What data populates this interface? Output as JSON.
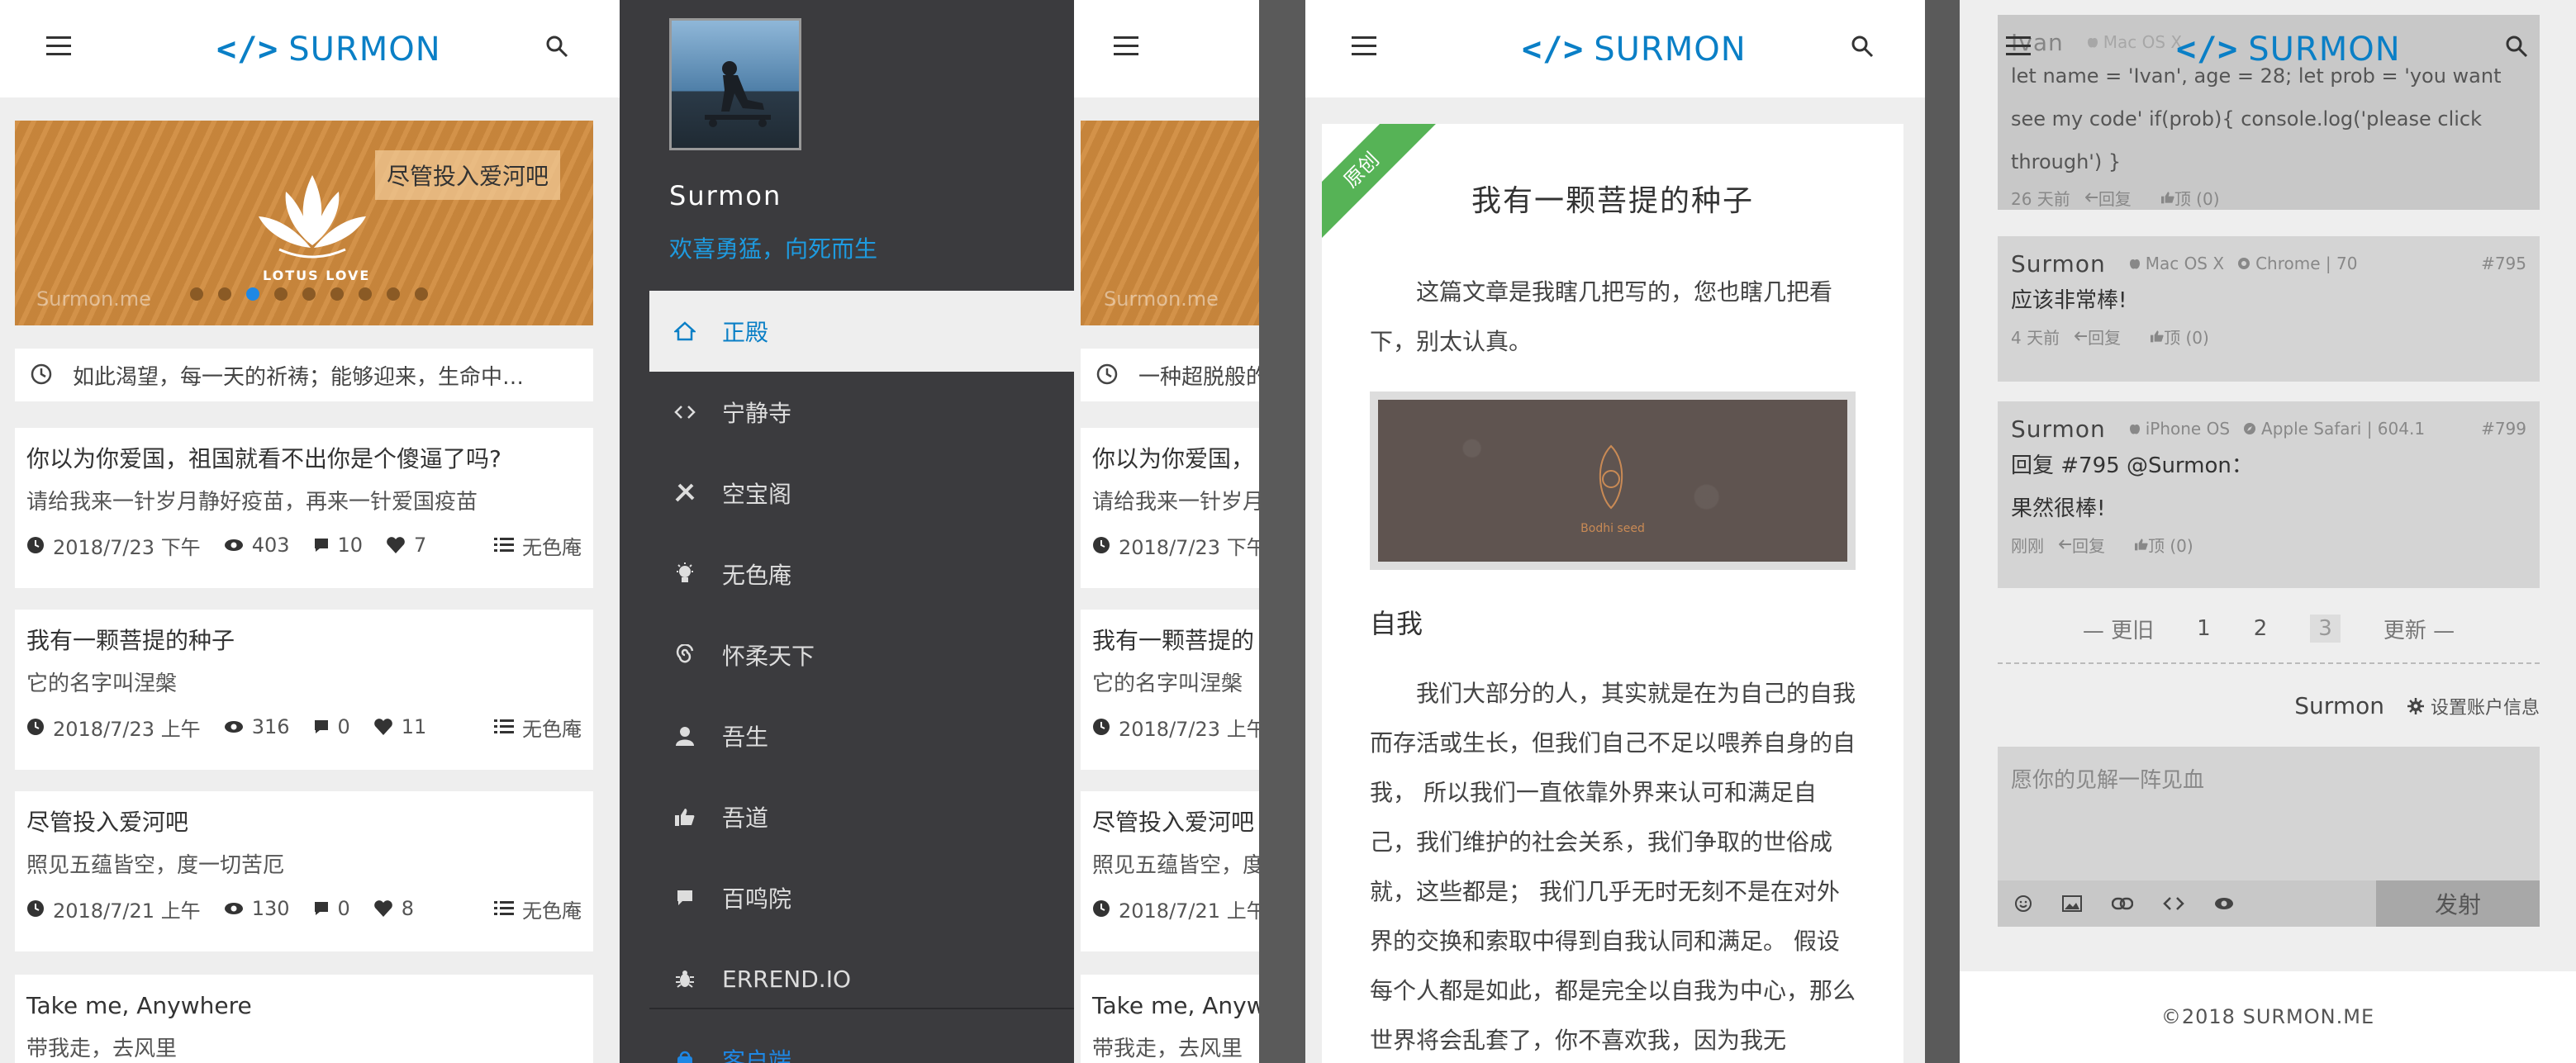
{
  "brand": {
    "logo_code": "</>",
    "logo_text": "SURMON"
  },
  "colors": {
    "accent": "#0a7fc6",
    "ribbon": "#56b356",
    "drawer_bg": "#3b3b3e",
    "drawer_slogan": "#1e9be0"
  },
  "home": {
    "banner": {
      "caption": "尽管投入爱河吧",
      "lotus_text": "LOTUS LOVE",
      "watermark": "Surmon.me",
      "dots_total": 9,
      "active_dot": 3
    },
    "notice": "如此渴望，每一天的祈祷；能够迎来，生命中…",
    "articles": [
      {
        "title": "你以为你爱国，祖国就看不出你是个傻逼了吗?",
        "desc": "请给我来一针岁月静好疫苗，再来一针爱国疫苗",
        "date": "2018/7/23 下午",
        "views": "403",
        "comments": "10",
        "likes": "7",
        "category": "无色庵"
      },
      {
        "title": "我有一颗菩提的种子",
        "desc": "它的名字叫涅槃",
        "date": "2018/7/23 上午",
        "views": "316",
        "comments": "0",
        "likes": "11",
        "category": "无色庵"
      },
      {
        "title": "尽管投入爱河吧",
        "desc": "照见五蕴皆空，度一切苦厄",
        "date": "2018/7/21 上午",
        "views": "130",
        "comments": "0",
        "likes": "8",
        "category": "无色庵"
      },
      {
        "title": "Take me, Anywhere",
        "desc": "带我走，去风里"
      }
    ]
  },
  "drawer": {
    "name": "Surmon",
    "slogan": "欢喜勇猛，向死而生",
    "items": [
      {
        "label": "正殿",
        "icon": "home-icon"
      },
      {
        "label": "宁静寺",
        "icon": "code-icon"
      },
      {
        "label": "空宝阁",
        "icon": "wrench-icon"
      },
      {
        "label": "无色庵",
        "icon": "lightbulb-icon"
      },
      {
        "label": "怀柔天下",
        "icon": "spiral-icon"
      },
      {
        "label": "吾生",
        "icon": "user-icon"
      },
      {
        "label": "吾道",
        "icon": "thumbs-up-icon"
      },
      {
        "label": "百鸣院",
        "icon": "chat-icon"
      },
      {
        "label": "ERREND.IO",
        "icon": "bug-icon"
      },
      {
        "label": "客户端",
        "icon": "app-icon"
      }
    ]
  },
  "partial": {
    "notice": "一种超脱般的",
    "articles": [
      {
        "title": "你以为你爱国，",
        "desc": "请给我来一针岁月",
        "date": "2018/7/23 下午"
      },
      {
        "title": "我有一颗菩提的",
        "desc": "它的名字叫涅槃",
        "date": "2018/7/23 上午"
      },
      {
        "title": "尽管投入爱河吧",
        "desc": "照见五蕴皆空，度",
        "date": "2018/7/21 上午"
      },
      {
        "title": "Take me, Anyw",
        "desc": "带我走，去风里"
      }
    ],
    "watermark": "Surmon.me"
  },
  "article": {
    "badge": "原创",
    "title": "我有一颗菩提的种子",
    "intro": "这篇文章是我瞎几把写的，您也瞎几把看下，别太认真。",
    "image_text": "Bodhi seed",
    "heading": "自我",
    "body": "我们大部分的人，其实就是在为自己的自我而存活或生长，但我们自己不足以喂养自身的自我， 所以我们一直依靠外界来认可和满足自己，我们维护的社会关系，我们争取的世俗成就，这些都是； 我们几乎无时无刻不是在对外界的交换和索取中得到自我认同和满足。 假设每个人都是如此，都是完全以自我为中心，那么世界将会乱套了，你不喜欢我，因为我无"
  },
  "comments": {
    "list": [
      {
        "name": "Ivan",
        "os": "Mac OS X",
        "browser": "",
        "id": "",
        "body": "let name = 'Ivan', age = 28; let prob = 'you want see my code' if(prob){ console.log('please click through') }",
        "time": "26 天前",
        "reply": "回复",
        "likes": "顶 (0)"
      },
      {
        "name": "Surmon",
        "os": "Mac OS X",
        "browser": "Chrome | 70",
        "id": "#795",
        "body": "应该非常棒!",
        "time": "4 天前",
        "reply": "回复",
        "likes": "顶 (0)"
      },
      {
        "name": "Surmon",
        "os": "iPhone OS",
        "browser": "Apple Safari | 604.1",
        "id": "#799",
        "reply_to": "回复 #795 @Surmon：",
        "body": "果然很棒!",
        "time": "刚刚",
        "reply": "回复",
        "likes": "顶 (0)"
      }
    ],
    "pager": {
      "prev": "— 更旧",
      "pages": [
        "1",
        "2",
        "3"
      ],
      "current": "3",
      "next": "更新 —"
    },
    "user_name": "Surmon",
    "settings": "设置账户信息",
    "placeholder": "愿你的见解一阵见血",
    "send": "发射"
  },
  "footer": "©2018  SURMON.ME"
}
